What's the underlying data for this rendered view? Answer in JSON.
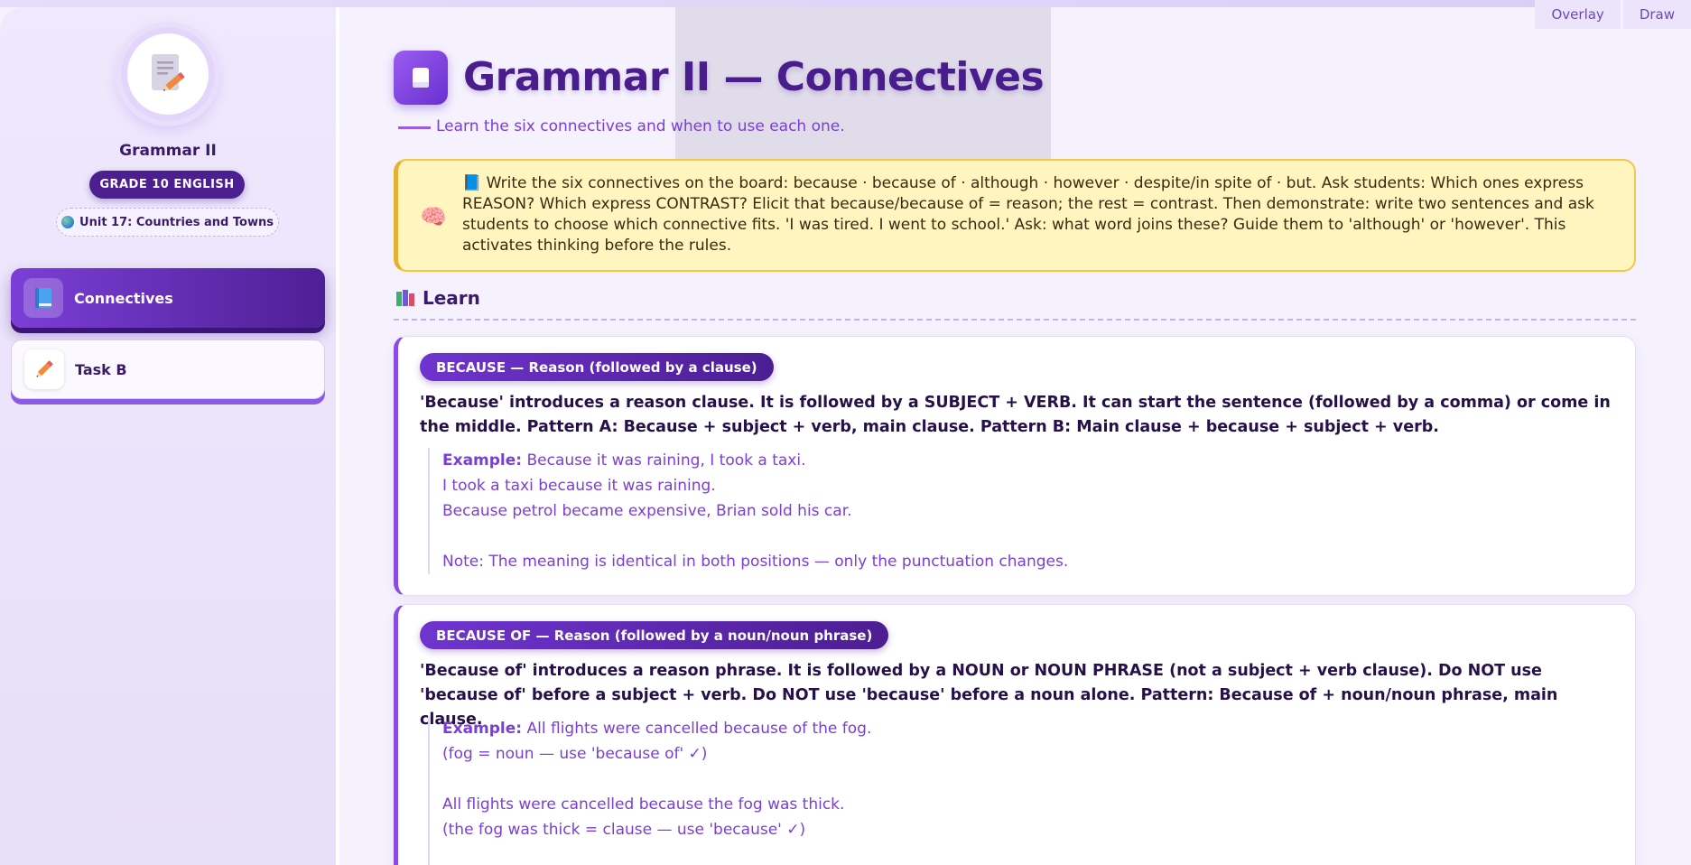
{
  "toolbar": {
    "overlay_label": "Overlay",
    "draw_label": "Draw"
  },
  "sidebar": {
    "course_name": "Grammar II",
    "grade_badge": "GRADE 10 ENGLISH",
    "unit_chip": "Unit 17: Countries and Towns",
    "items": [
      {
        "label": "Connectives",
        "icon": "book-icon",
        "active": true
      },
      {
        "label": "Task B",
        "icon": "pencil-icon",
        "active": false
      }
    ]
  },
  "main": {
    "title": "Grammar II — Connectives",
    "subtitle": "Learn the six connectives and when to use each one.",
    "teacher_note": "📘 Write the six connectives on the board: because · because of · although · however · despite/in spite of · but. Ask students: Which ones express REASON? Which express CONTRAST? Elicit that because/because of = reason; the rest = contrast. Then demonstrate: write two sentences and ask students to choose which connective fits. 'I was tired. I went to school.' Ask: what word joins these? Guide them to 'although' or 'however'. This activates thinking before the rules.",
    "section_title": "Learn",
    "cards": [
      {
        "pill": "BECAUSE — Reason (followed by a clause)",
        "rule": "'Because' introduces a reason clause. It is followed by a SUBJECT + VERB. It can start the sentence (followed by a comma) or come in the middle. Pattern A: Because + subject + verb, main clause. Pattern B: Main clause + because + subject + verb.",
        "example_label": "Example:",
        "lines": [
          "Because it was raining, I took a taxi.",
          "I took a taxi because it was raining.",
          "Because petrol became expensive, Brian sold his car.",
          "",
          "Note: The meaning is identical in both positions — only the punctuation changes."
        ]
      },
      {
        "pill": "BECAUSE OF — Reason (followed by a noun/noun phrase)",
        "rule": "'Because of' introduces a reason phrase. It is followed by a NOUN or NOUN PHRASE (not a subject + verb clause). Do NOT use 'because of' before a subject + verb. Do NOT use 'because' before a noun alone. Pattern: Because of + noun/noun phrase, main clause.",
        "example_label": "Example:",
        "lines": [
          "All flights were cancelled because of the fog.",
          "(fog = noun — use 'because of' ✓)",
          "",
          "All flights were cancelled because the fog was thick.",
          "(the fog was thick = clause — use 'because' ✓)"
        ]
      }
    ]
  }
}
